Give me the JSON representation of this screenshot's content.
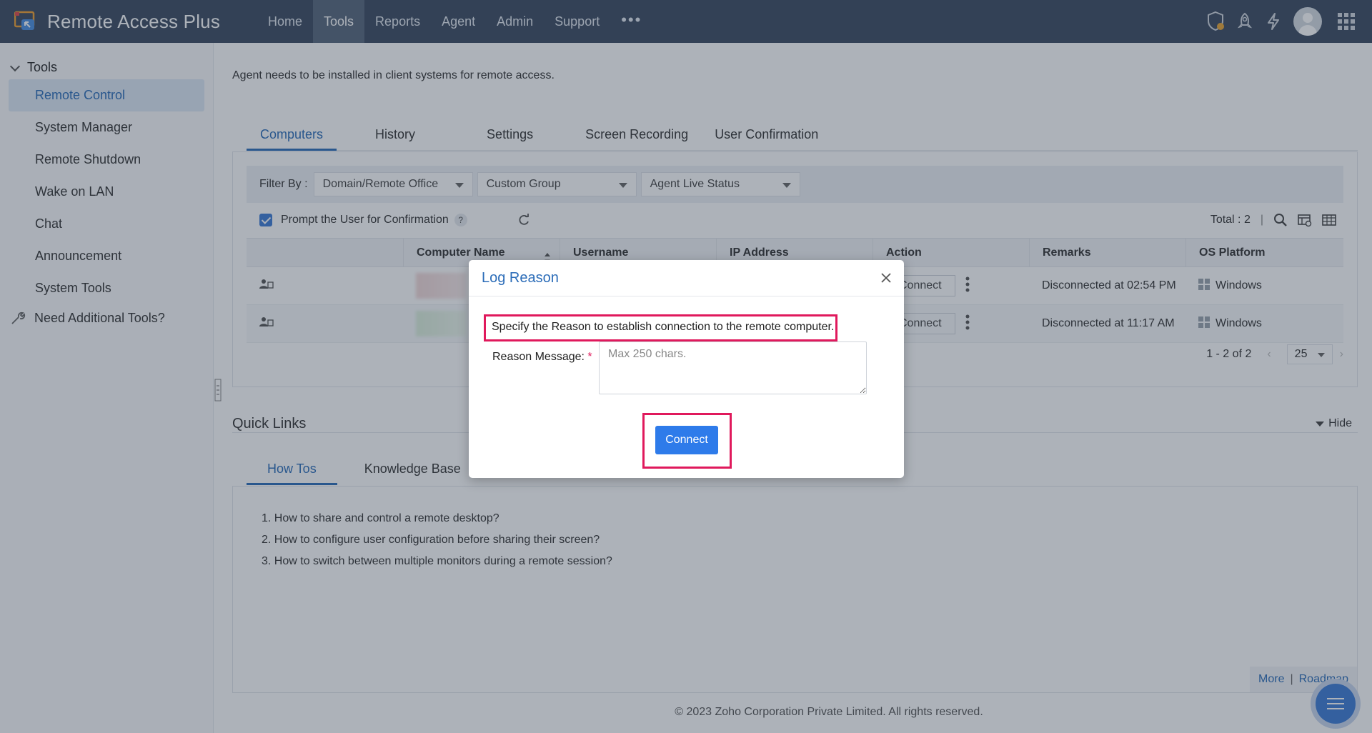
{
  "app": {
    "title": "Remote Access Plus"
  },
  "nav": {
    "items": [
      {
        "label": "Home"
      },
      {
        "label": "Tools"
      },
      {
        "label": "Reports"
      },
      {
        "label": "Agent"
      },
      {
        "label": "Admin"
      },
      {
        "label": "Support"
      }
    ],
    "more_label": "•••",
    "active": "Tools"
  },
  "sidebar": {
    "header": "Tools",
    "items": [
      {
        "label": "Remote Control"
      },
      {
        "label": "System Manager"
      },
      {
        "label": "Remote Shutdown"
      },
      {
        "label": "Wake on LAN"
      },
      {
        "label": "Chat"
      },
      {
        "label": "Announcement"
      },
      {
        "label": "System Tools"
      }
    ],
    "extra": "Need Additional Tools?"
  },
  "main": {
    "notice": "Agent needs to be installed in client systems for remote access.",
    "tabs": [
      {
        "label": "Computers"
      },
      {
        "label": "History"
      },
      {
        "label": "Settings"
      },
      {
        "label": "Screen Recording"
      },
      {
        "label": "User Confirmation"
      }
    ],
    "filter": {
      "label": "Filter By :",
      "selects": [
        "Domain/Remote Office",
        "Custom Group",
        "Agent Live Status"
      ]
    },
    "prompt_label": "Prompt the User for Confirmation",
    "help": "?",
    "total": "Total : 2",
    "divider": "|",
    "columns": [
      "Computer Name",
      "Username",
      "IP Address",
      "Action",
      "Remarks",
      "OS Platform"
    ],
    "rows": [
      {
        "action": "Connect",
        "remarks": "Disconnected at 02:54 PM",
        "os": "Windows"
      },
      {
        "action": "Connect",
        "remarks": "Disconnected at 11:17 AM",
        "os": "Windows"
      }
    ],
    "pager": {
      "range": "1 - 2 of 2",
      "page_size": "25"
    }
  },
  "quick_links": {
    "title": "Quick Links",
    "hide": "Hide",
    "tabs": [
      {
        "label": "How Tos"
      },
      {
        "label": "Knowledge Base"
      }
    ],
    "items": [
      "1. How to share and control a remote desktop?",
      "2. How to configure user configuration before sharing their screen?",
      "3. How to switch between multiple monitors during a remote session?"
    ],
    "more": "More",
    "separator": "|",
    "roadmap": "Roadmap"
  },
  "footer": {
    "copyright": "© 2023 Zoho Corporation Private Limited.  All rights reserved."
  },
  "modal": {
    "title": "Log Reason",
    "instruction": "Specify the Reason to establish connection to the remote computer.",
    "reason_label": "Reason Message:",
    "required_mark": "*",
    "placeholder": "Max 250 chars.",
    "reason_value": "",
    "connect_label": "Connect"
  },
  "colors": {
    "topbar": "#3a4a5f",
    "accent": "#2b6cb8",
    "highlight": "#e0195c",
    "button": "#2e7bea"
  }
}
